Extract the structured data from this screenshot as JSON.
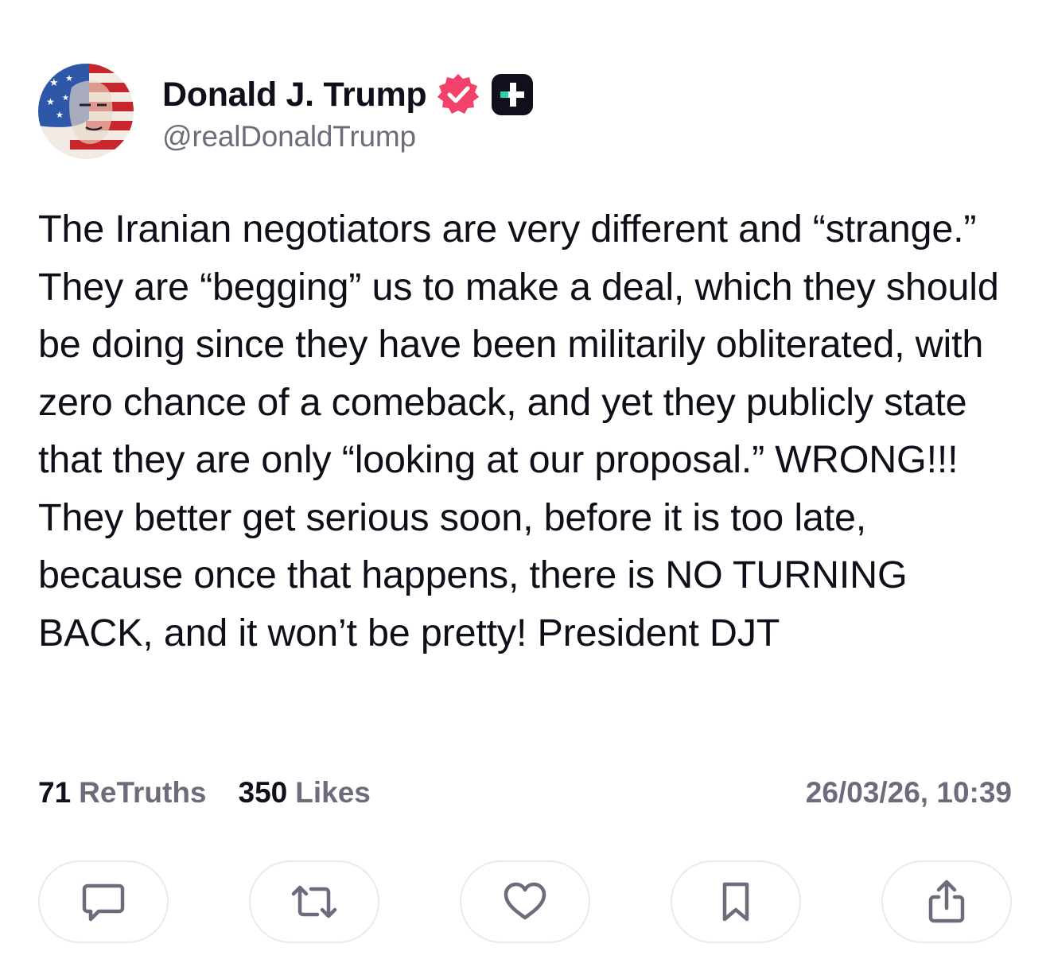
{
  "author": {
    "display_name": "Donald J. Trump",
    "handle": "@realDonaldTrump",
    "verified_icon": "verified-check-badge",
    "plus_icon": "plus-badge",
    "avatar_icon": "profile-avatar"
  },
  "post": {
    "text": "The Iranian negotiators are very different and “strange.” They are “begging” us to make a deal, which they should be doing since they have been militarily obliterated, with zero chance of a comeback, and yet they publicly state that they are only “looking at our proposal.” WRONG!!! They better get serious soon, before it is too late, because once that happens, there is NO TURNING BACK, and it won’t be pretty! President DJT"
  },
  "stats": {
    "retruths_count": "71",
    "retruths_label": "ReTruths",
    "likes_count": "350",
    "likes_label": "Likes",
    "timestamp": "26/03/26, 10:39"
  },
  "actions": [
    {
      "icon": "comment-icon"
    },
    {
      "icon": "retruth-icon"
    },
    {
      "icon": "heart-icon"
    },
    {
      "icon": "bookmark-icon"
    },
    {
      "icon": "share-icon"
    }
  ],
  "colors": {
    "text": "#0f0f1a",
    "muted": "#6e6c7c",
    "verified": "#f2416b",
    "border": "#ebe9ef"
  }
}
